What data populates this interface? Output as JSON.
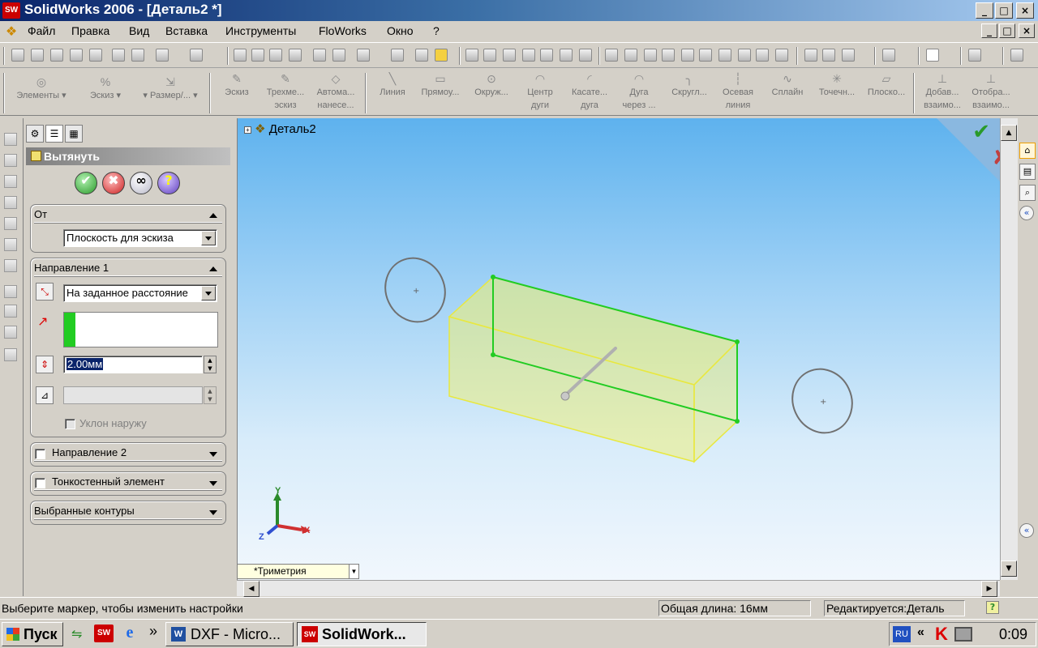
{
  "window": {
    "title": "SolidWorks 2006 - [Деталь2 *]",
    "logo_text": "SW",
    "min_glyph": "_",
    "max_glyph": "□",
    "close_glyph": "×"
  },
  "menu": {
    "items": [
      "Файл",
      "Правка",
      "Вид",
      "Вставка",
      "Инструменты",
      "FloWorks",
      "Окно",
      "?"
    ]
  },
  "commands": {
    "left_group": [
      {
        "label": "Элементы",
        "icon": "features-icon"
      },
      {
        "label": "Эскиз",
        "icon": "sketch-icon"
      },
      {
        "label": "Размер/...",
        "icon": "dimension-icon"
      }
    ],
    "sketch_tools": [
      {
        "line1": "Эскиз",
        "line2": ""
      },
      {
        "line1": "Трехме...",
        "line2": "эскиз"
      },
      {
        "line1": "Автома...",
        "line2": "нанесе..."
      },
      {
        "line1": "Линия",
        "line2": ""
      },
      {
        "line1": "Прямоу...",
        "line2": ""
      },
      {
        "line1": "Окруж...",
        "line2": ""
      },
      {
        "line1": "Центр",
        "line2": "дуги"
      },
      {
        "line1": "Касате...",
        "line2": "дуга"
      },
      {
        "line1": "Дуга",
        "line2": "через ..."
      },
      {
        "line1": "Скругл...",
        "line2": ""
      },
      {
        "line1": "Осевая",
        "line2": "линия"
      },
      {
        "line1": "Сплайн",
        "line2": ""
      },
      {
        "line1": "Точечн...",
        "line2": ""
      },
      {
        "line1": "Плоско...",
        "line2": ""
      },
      {
        "line1": "Добав...",
        "line2": "взаимо..."
      },
      {
        "line1": "Отобра...",
        "line2": "взаимо..."
      }
    ]
  },
  "property_manager": {
    "title": "Вытянуть",
    "buttons": {
      "ok": "✔",
      "cancel": "✖",
      "detail": "∞",
      "help": "?"
    },
    "from": {
      "header": "От",
      "value": "Плоскость для эскиза"
    },
    "direction1": {
      "header": "Направление 1",
      "end_condition": "На заданное расстояние",
      "depth": "2.00мм",
      "draft_outward": "Уклон наружу"
    },
    "direction2": {
      "header": "Направление 2"
    },
    "thin_feature": {
      "header": "Тонкостенный элемент"
    },
    "selected_contours": {
      "header": "Выбранные контуры"
    }
  },
  "graphics": {
    "tree_root": "Деталь2",
    "view_orientation": "*Триметрия",
    "confirm_ok": "✔",
    "confirm_cancel": "✘",
    "axes": {
      "x": "X",
      "y": "Y",
      "z": "Z"
    }
  },
  "status": {
    "message": "Выберите маркер, чтобы изменить настройки",
    "length": "Общая длина: 16мм",
    "editing": "Редактируется:Деталь",
    "help": "?"
  },
  "taskbar": {
    "start": "Пуск",
    "chevron": "»",
    "buttons": [
      "DXF - Micro...",
      "SolidWork..."
    ],
    "lang": "RU",
    "tray_chevron": "«",
    "clock": "0:09"
  },
  "colors": {
    "selection_green": "#22cc22",
    "preview_yellow": "#f0f070",
    "accent_red": "#cc0000"
  }
}
